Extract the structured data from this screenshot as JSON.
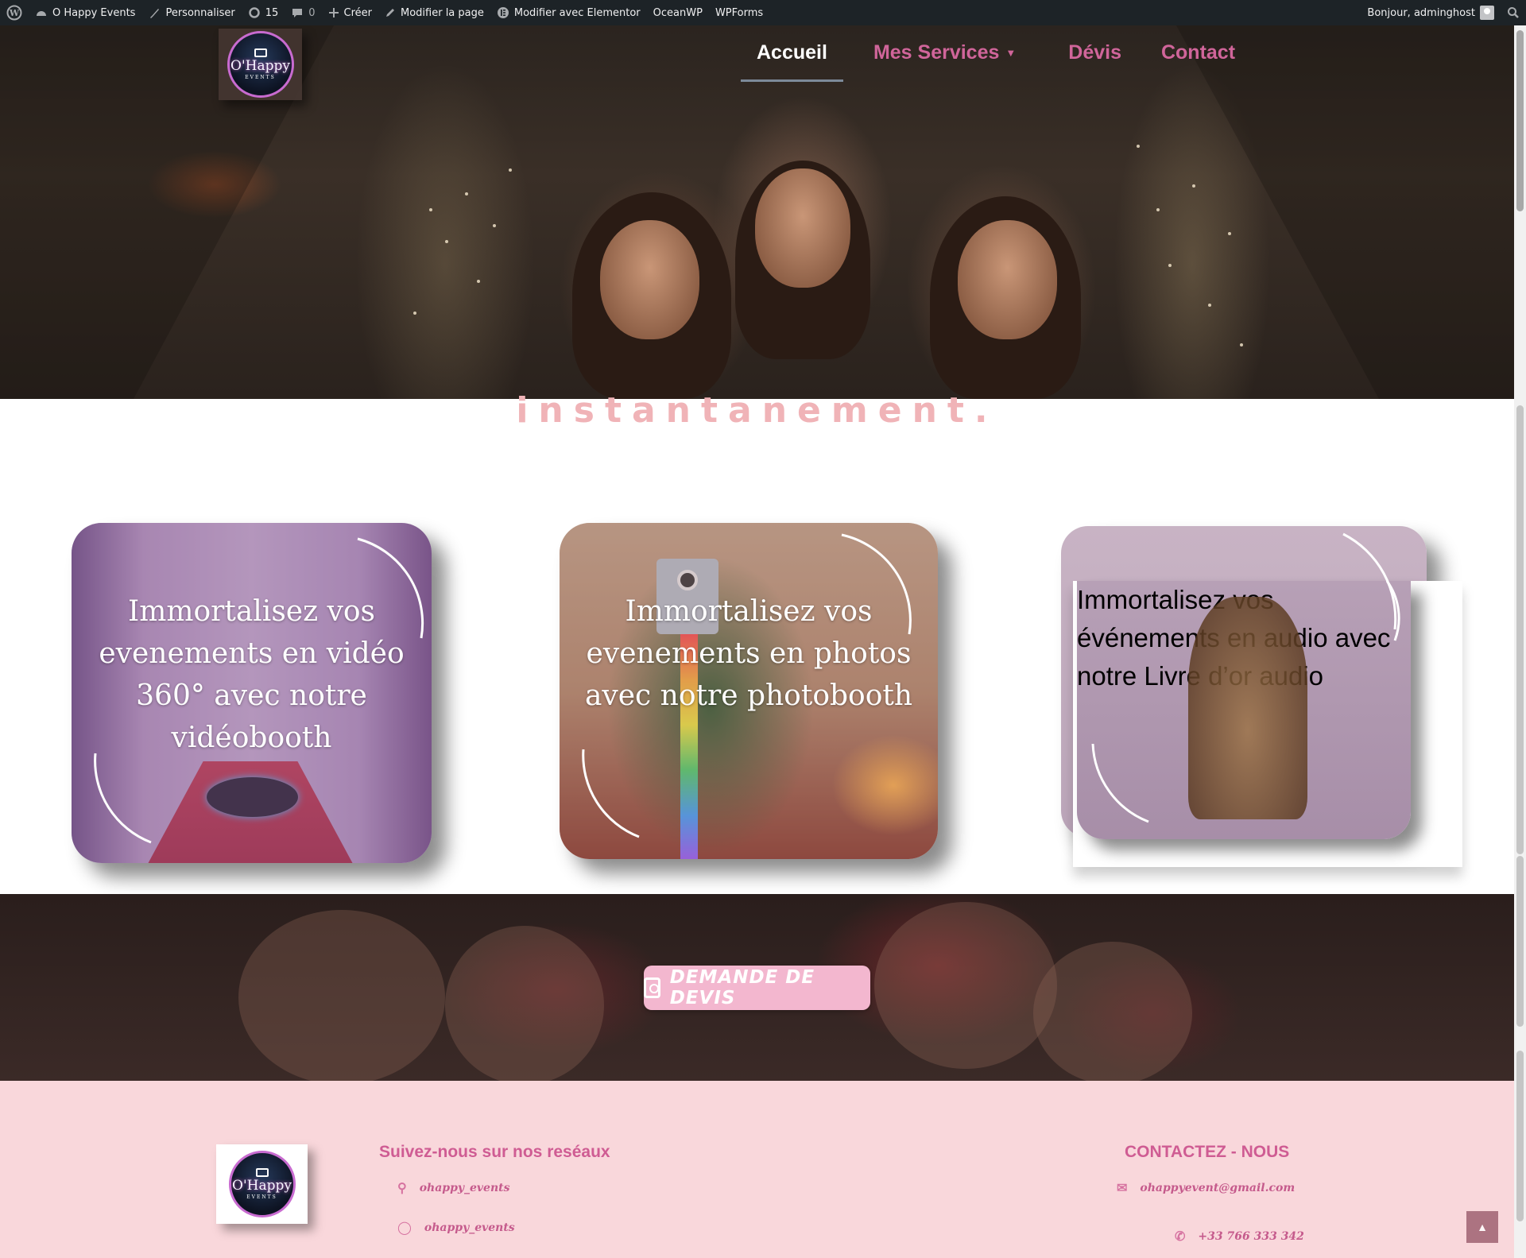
{
  "admin_bar": {
    "site_name": "O Happy Events",
    "customize": "Personnaliser",
    "updates_count": "15",
    "comments_count": "0",
    "new": "Créer",
    "edit_page": "Modifier la page",
    "edit_elementor": "Modifier avec Elementor",
    "oceanwp": "OceanWP",
    "wpforms": "WPForms",
    "greeting": "Bonjour, adminghost"
  },
  "header": {
    "logo": {
      "name": "O'Happy",
      "tagline": "EVENTS"
    },
    "nav": [
      {
        "label": "Accueil",
        "active": true
      },
      {
        "label": "Mes Services",
        "has_dropdown": true
      },
      {
        "label": "Dévis"
      },
      {
        "label": "Contact"
      }
    ]
  },
  "tagline": "instantanement.",
  "cards": [
    {
      "text": "Immortalisez vos evenements en vidéo 360° avec notre vidéobooth"
    },
    {
      "text": "Immortalisez vos evenements en photos avec notre photobooth"
    },
    {
      "text": "Immortalisez vos événements en audio avec notre Livre d’or audio"
    }
  ],
  "cta": {
    "label": "DEMANDE DE DEVIS"
  },
  "footer": {
    "logo": {
      "name": "O'Happy",
      "tagline": "EVENTS"
    },
    "social_title": "Suivez-nous sur nos reséaux",
    "social": [
      {
        "icon": "snapchat-icon",
        "handle": "ohappy_events"
      },
      {
        "icon": "instagram-icon",
        "handle": "ohappy_events"
      }
    ],
    "contact_title": "CONTACTEZ - NOUS",
    "email": "ohappyevent@gmail.com",
    "phone": "+33 766 333 342"
  },
  "colors": {
    "brand_pink": "#d0659a",
    "footer_bg": "#f9d7db",
    "admin_bar_bg": "#1d2327",
    "cta_bg": "#f3b7cf"
  }
}
